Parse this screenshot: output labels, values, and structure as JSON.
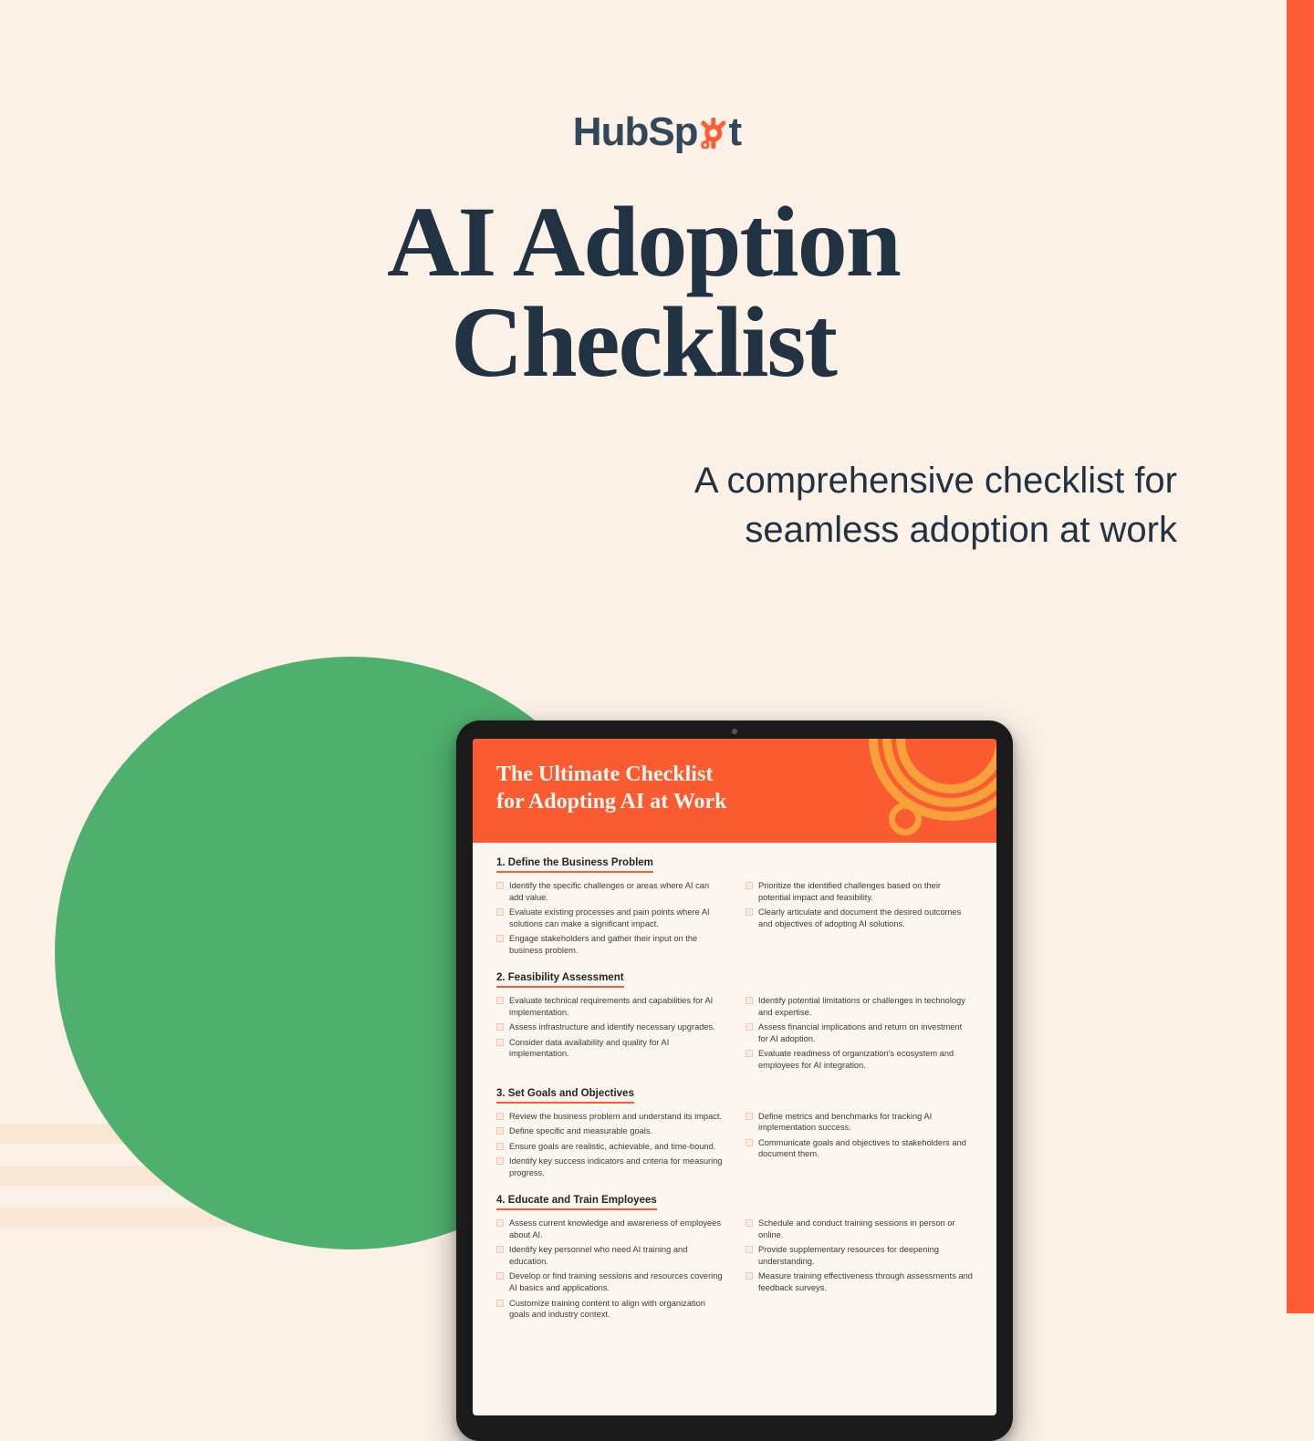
{
  "brand": "HubSpot",
  "title_line1": "AI Adoption",
  "title_line2": "Checklist",
  "subtitle": "A comprehensive checklist for seamless adoption at work",
  "colors": {
    "bg": "#fbf1e7",
    "accent": "#ff5c35",
    "green": "#4fb06d",
    "ink": "#213343"
  },
  "doc": {
    "header_line1": "The Ultimate Checklist",
    "header_line2": "for Adopting AI at Work",
    "sections": [
      {
        "title": "1. Define the Business Problem",
        "left": [
          "Identify the specific challenges or areas where AI can add value.",
          "Evaluate existing processes and pain points where AI solutions can make a significant impact.",
          "Engage stakeholders and gather their input on the business problem."
        ],
        "right": [
          "Prioritize the identified challenges based on their potential impact and feasibility.",
          "Clearly articulate and document the desired outcomes and objectives of adopting AI solutions."
        ]
      },
      {
        "title": "2. Feasibility Assessment",
        "left": [
          "Evaluate technical requirements and capabilities for AI implementation.",
          "Assess infrastructure and identify necessary upgrades.",
          "Consider data availability and quality for AI implementation."
        ],
        "right": [
          "Identify potential limitations or challenges in technology and expertise.",
          "Assess financial implications and return on investment for AI adoption.",
          "Evaluate readiness of organization's ecosystem and employees for AI integration."
        ]
      },
      {
        "title": "3. Set Goals and Objectives",
        "left": [
          "Review the business problem and understand its impact.",
          "Define specific and measurable goals.",
          "Ensure goals are realistic, achievable, and time-bound.",
          "Identify key success indicators and criteria for measuring progress."
        ],
        "right": [
          "Define metrics and benchmarks for tracking AI implementation success.",
          "Communicate goals and objectives to stakeholders and document them."
        ]
      },
      {
        "title": "4. Educate and Train Employees",
        "left": [
          "Assess current knowledge and awareness of employees about AI.",
          "Identify key personnel who need AI training and education.",
          "Develop or find training sessions and resources covering AI basics and applications.",
          "Customize training content to align with organization goals and industry context."
        ],
        "right": [
          "Schedule and conduct training sessions in person or online.",
          "Provide supplementary resources for deepening understanding.",
          "Measure training effectiveness through assessments and feedback surveys."
        ]
      }
    ]
  }
}
